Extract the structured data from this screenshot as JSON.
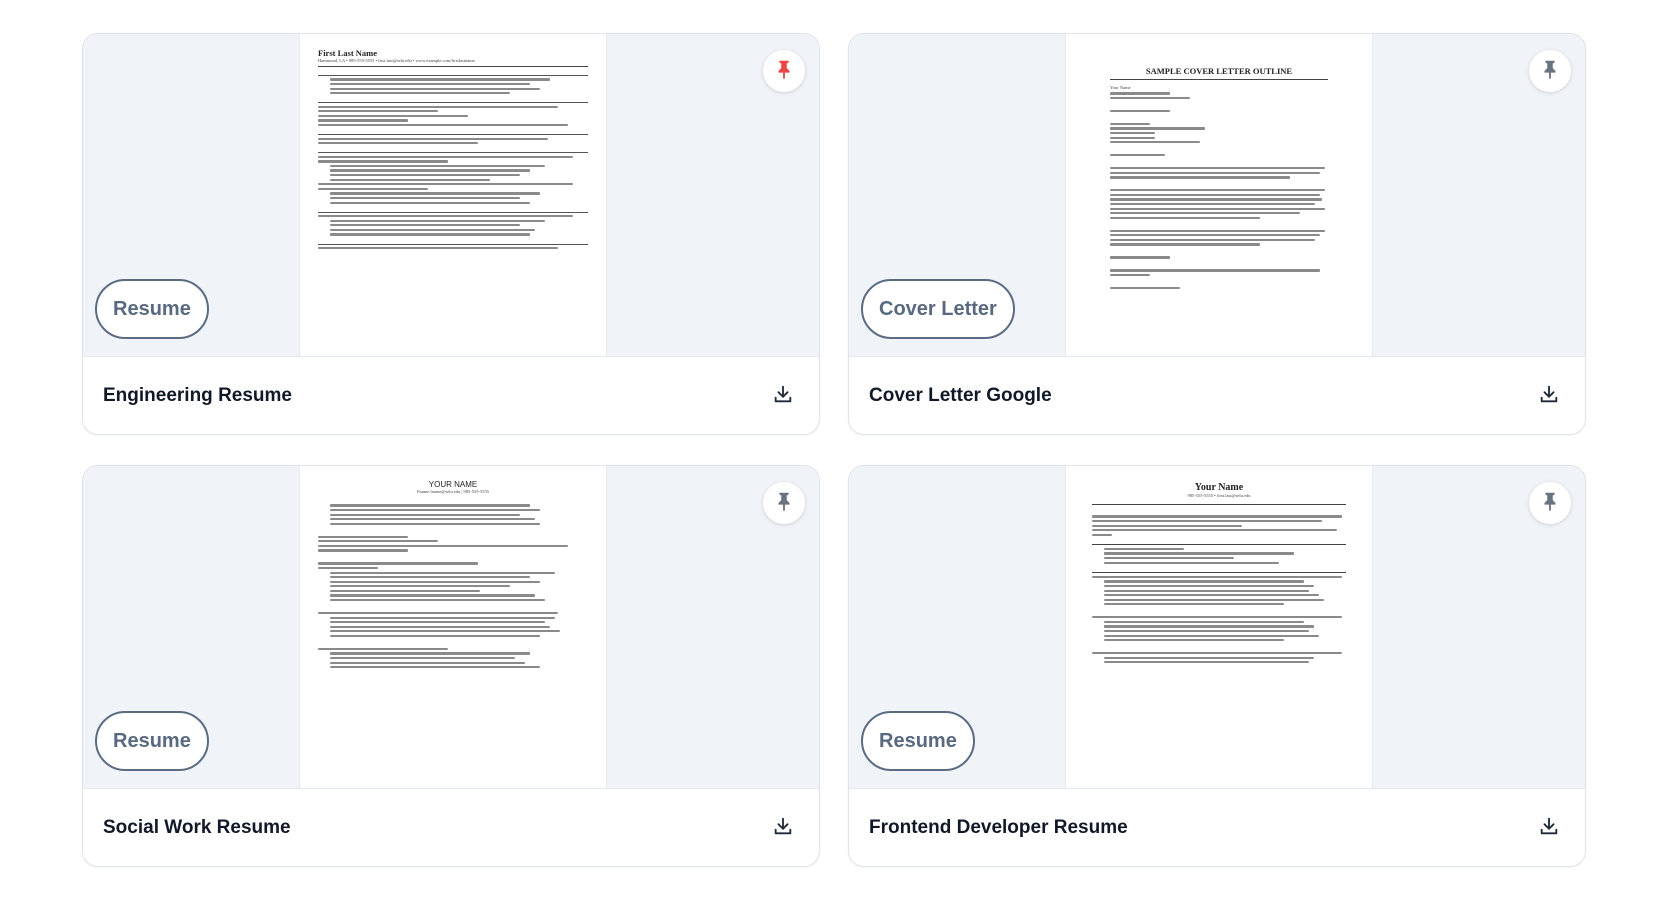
{
  "cards": [
    {
      "title": "Engineering Resume",
      "tag": "Resume",
      "pinned": true,
      "pin_color": "#ef4444",
      "pin_icon": "pushpin-icon",
      "download_icon": "download-icon",
      "preview": {
        "heading": "First Last Name",
        "subline": "Hammond, LA • 985-555-5555 • first.last@selu.edu • www.example.com/firstlastname"
      }
    },
    {
      "title": "Cover Letter Google",
      "tag": "Cover Letter",
      "pinned": false,
      "pin_color": "#6b7280",
      "pin_icon": "pushpin-icon",
      "download_icon": "download-icon",
      "preview": {
        "heading": "SAMPLE COVER LETTER OUTLINE",
        "subline": "Your Name"
      }
    },
    {
      "title": "Social Work Resume",
      "tag": "Resume",
      "pinned": false,
      "pin_color": "#6b7280",
      "pin_icon": "pushpin-icon",
      "download_icon": "download-icon",
      "preview": {
        "heading": "YOUR NAME",
        "subline": "Fname.lname@selu.edu | 985-555-5555"
      }
    },
    {
      "title": "Frontend Developer Resume",
      "tag": "Resume",
      "pinned": false,
      "pin_color": "#6b7280",
      "pin_icon": "pushpin-icon",
      "download_icon": "download-icon",
      "preview": {
        "heading": "Your Name",
        "subline": "985-555-5555 • first.last@selu.edu"
      }
    }
  ]
}
